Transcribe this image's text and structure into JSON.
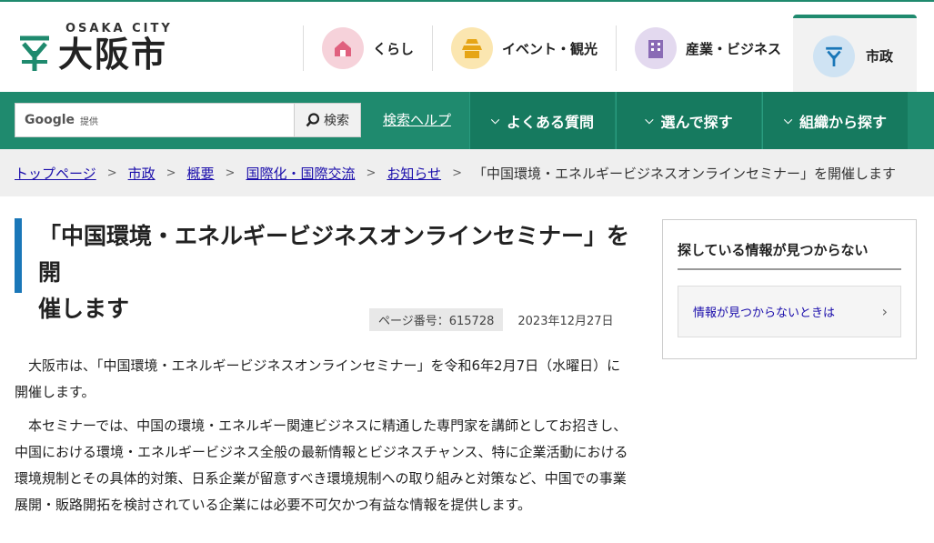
{
  "header": {
    "logo_en": "OSAKA CITY",
    "logo_ja": "大阪市",
    "nav": [
      {
        "label": "くらし",
        "icon": "house-icon",
        "color": "#f6d2da"
      },
      {
        "label": "イベント・観光",
        "icon": "castle-icon",
        "color": "#fbe6b0"
      },
      {
        "label": "産業・ビジネス",
        "icon": "building-icon",
        "color": "#e3d9ef"
      },
      {
        "label": "市政",
        "icon": "city-emblem-icon",
        "color": "#cfe3f3"
      }
    ]
  },
  "search": {
    "google_label": "Google",
    "provided": "提供",
    "placeholder": "",
    "button_label": "検索",
    "help_label": "検索ヘルプ"
  },
  "menu": {
    "faq": "よくある質問",
    "choose": "選んで探す",
    "org": "組織から探す"
  },
  "breadcrumb": {
    "items": [
      "トップページ",
      "市政",
      "概要",
      "国際化・国際交流",
      "お知らせ"
    ],
    "current": "「中国環境・エネルギービジネスオンラインセミナー」を開催します"
  },
  "article": {
    "title_line1": "「中国環境・エネルギービジネスオンラインセミナー」を開",
    "title_line2": "催します",
    "page_number": "ページ番号：615728",
    "date": "2023年12月27日",
    "para1": "大阪市は、「中国環境・エネルギービジネスオンラインセミナー」を令和6年2月7日（水曜日）に開催します。",
    "para2": "本セミナーでは、中国の環境・エネルギー関連ビジネスに精通した専門家を講師としてお招きし、中国における環境・エネルギービジネス全般の最新情報とビジネスチャンス、特に企業活動における環境規制とその具体的対策、日系企業が留意すべき環境規制への取り組みと対策など、中国での事業展開・販路開拓を検討されている企業には必要不可欠かつ有益な情報を提供します。"
  },
  "sidebar": {
    "title": "探している情報が見つからない",
    "link": "情報が見つからないときは"
  },
  "colors": {
    "brand_green": "#1f8a6e",
    "dark_green": "#167a5f",
    "title_bar_blue": "#1a77b8",
    "link_blue": "#1a0dab"
  }
}
